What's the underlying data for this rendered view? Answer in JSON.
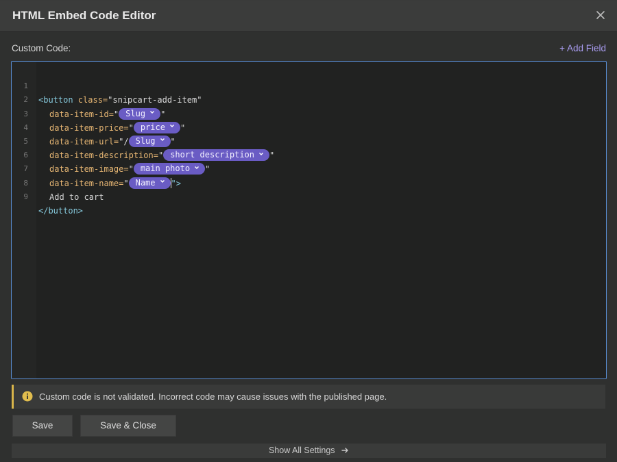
{
  "dialog": {
    "title": "HTML Embed Code Editor",
    "close_icon": "close-icon"
  },
  "editor": {
    "label": "Custom Code:",
    "add_field": "+ Add Field",
    "lines": [
      {
        "num": "1"
      },
      {
        "num": "2"
      },
      {
        "num": "3"
      },
      {
        "num": "4"
      },
      {
        "num": "5"
      },
      {
        "num": "6"
      },
      {
        "num": "7"
      },
      {
        "num": "8"
      },
      {
        "num": "9"
      }
    ],
    "code": {
      "l1_open": "<button",
      "l1_attr": " class=",
      "l1_val": "\"snipcart-add-item\"",
      "l2_attr": "data-item-id=",
      "l2_pill": "Slug",
      "l3_attr": "data-item-price=",
      "l3_pill": "price",
      "l4_attr": "data-item-url=",
      "l4_prefix": "\"/",
      "l4_pill": "Slug",
      "l5_attr": "data-item-description=",
      "l5_pill": "short description",
      "l6_attr": "data-item-image=",
      "l6_pill": "main photo",
      "l7_attr": "data-item-name=",
      "l7_pill": "Name",
      "l7_end": "\">",
      "l8_text": "Add to cart",
      "l9_close": "</button>",
      "quote": "\""
    }
  },
  "warning": {
    "text": "Custom code is not validated. Incorrect code may cause issues with the published page.",
    "color": "#d9b54a"
  },
  "buttons": {
    "save": "Save",
    "save_close": "Save & Close"
  },
  "footer": {
    "show_all": "Show All Settings"
  },
  "colors": {
    "pill": "#6a5cc4",
    "accent": "#a99cf0",
    "editor_border": "#5a8fd6"
  }
}
